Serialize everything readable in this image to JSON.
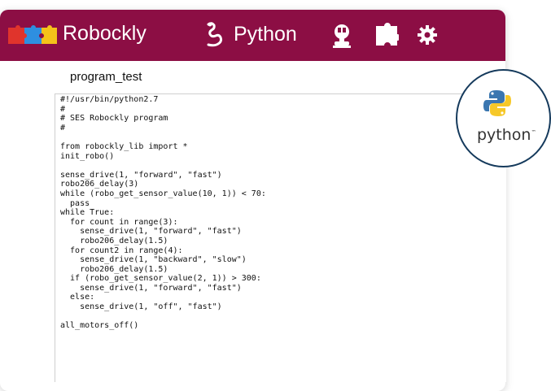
{
  "header": {
    "app_title": "Robockly",
    "python_label": "Python",
    "brand_color": "#8c0e44",
    "icons": [
      "puzzle-logo-icon",
      "snake-icon",
      "robot-icon",
      "puzzle-icon",
      "gear-icon"
    ]
  },
  "program": {
    "name": "program_test"
  },
  "editor": {
    "code": "#!/usr/bin/python2.7\n#\n# SES Robockly program\n#\n\nfrom robockly_lib import *\ninit_robo()\n\nsense_drive(1, \"forward\", \"fast\")\nrobo206_delay(3)\nwhile (robo_get_sensor_value(10, 1)) < 70:\n  pass\nwhile True:\n  for count in range(3):\n    sense_drive(1, \"forward\", \"fast\")\n    robo206_delay(1.5)\n  for count2 in range(4):\n    sense_drive(1, \"backward\", \"slow\")\n    robo206_delay(1.5)\n  if (robo_get_sensor_value(2, 1)) > 300:\n    sense_drive(1, \"forward\", \"fast\")\n  else:\n    sense_drive(1, \"off\", \"fast\")\n\nall_motors_off()"
  },
  "badge": {
    "text": "python",
    "tm": "™",
    "icon": "python-logo-icon"
  }
}
